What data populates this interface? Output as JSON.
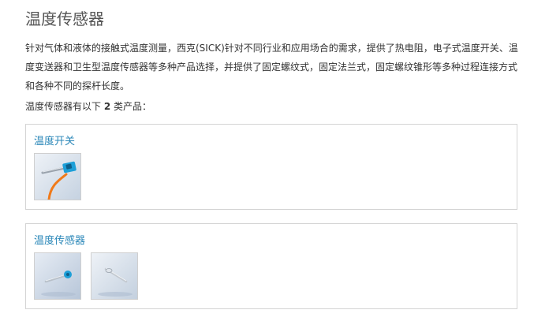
{
  "page": {
    "title": "温度传感器",
    "intro": "针对气体和液体的接触式温度测量，西克(SICK)针对不同行业和应用场合的需求，提供了热电阻，电子式温度开关、温度变送器和卫生型温度传感器等多种产品选择，并提供了固定螺纹式，固定法兰式，固定螺纹锥形等多种过程连接方式和各种不同的探杆长度。",
    "count_prefix": "温度传感器有以下",
    "count_value": "2",
    "count_suffix": "类产品："
  },
  "categories": [
    {
      "title": "温度开关",
      "image_icon": "temperature-switch-product-photo"
    },
    {
      "title": "温度传感器",
      "image_icons": [
        "temperature-sensor-product-photo-1",
        "temperature-sensor-product-photo-2"
      ]
    }
  ],
  "colors": {
    "link": "#2a87b8",
    "border": "#d4d4d4",
    "accent_blue": "#1d9fd8",
    "cable_orange": "#f07a1a"
  }
}
